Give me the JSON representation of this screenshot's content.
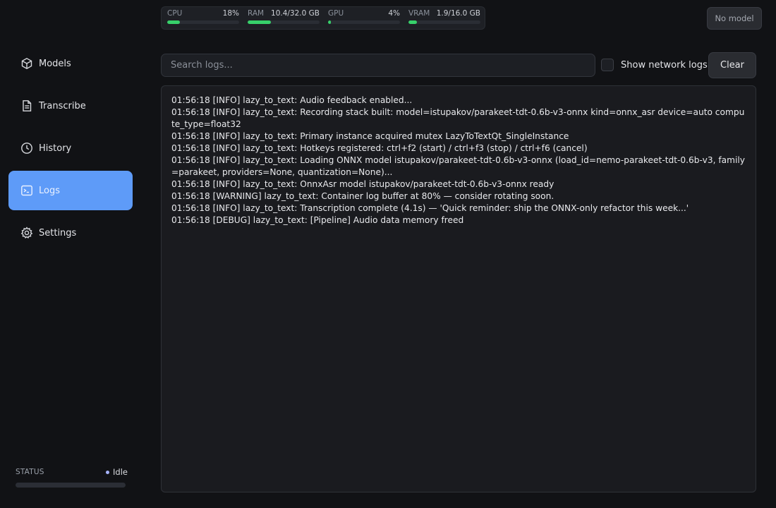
{
  "sidebar": {
    "items": [
      {
        "label": "Models",
        "icon": "cube-icon"
      },
      {
        "label": "Transcribe",
        "icon": "document-icon"
      },
      {
        "label": "History",
        "icon": "clock-icon"
      },
      {
        "label": "Logs",
        "icon": "terminal-icon",
        "active": true
      },
      {
        "label": "Settings",
        "icon": "gear-icon"
      }
    ],
    "status": {
      "label": "STATUS",
      "value": "Idle"
    }
  },
  "metrics": [
    {
      "name": "CPU",
      "value": "18%",
      "fill_fraction": 0.18
    },
    {
      "name": "RAM",
      "value": "10.4/32.0 GB",
      "fill_fraction": 0.325
    },
    {
      "name": "GPU",
      "value": "4%",
      "fill_fraction": 0.04
    },
    {
      "name": "VRAM",
      "value": "1.9/16.0 GB",
      "fill_fraction": 0.119
    }
  ],
  "header": {
    "model_button": "No model"
  },
  "toolbar": {
    "search_placeholder": "Search logs...",
    "show_network_label": "Show network logs",
    "clear_label": "Clear"
  },
  "logs": [
    "01:56:18 [INFO] lazy_to_text: Audio feedback enabled...",
    "01:56:18 [INFO] lazy_to_text: Recording stack built: model=istupakov/parakeet-tdt-0.6b-v3-onnx kind=onnx_asr device=auto compute_type=float32",
    "01:56:18 [INFO] lazy_to_text: Primary instance acquired mutex LazyToTextQt_SingleInstance",
    "01:56:18 [INFO] lazy_to_text: Hotkeys registered: ctrl+f2 (start) / ctrl+f3 (stop) / ctrl+f6 (cancel)",
    "01:56:18 [INFO] lazy_to_text: Loading ONNX model istupakov/parakeet-tdt-0.6b-v3-onnx (load_id=nemo-parakeet-tdt-0.6b-v3, family=parakeet, providers=None, quantization=None)...",
    "01:56:18 [INFO] lazy_to_text: OnnxAsr model istupakov/parakeet-tdt-0.6b-v3-onnx ready",
    "01:56:18 [WARNING] lazy_to_text: Container log buffer at 80% — consider rotating soon.",
    "01:56:18 [INFO] lazy_to_text: Transcription complete (4.1s) — 'Quick reminder: ship the ONNX-only refactor this week...'",
    "01:56:18 [DEBUG] lazy_to_text: [Pipeline] Audio data memory freed"
  ]
}
